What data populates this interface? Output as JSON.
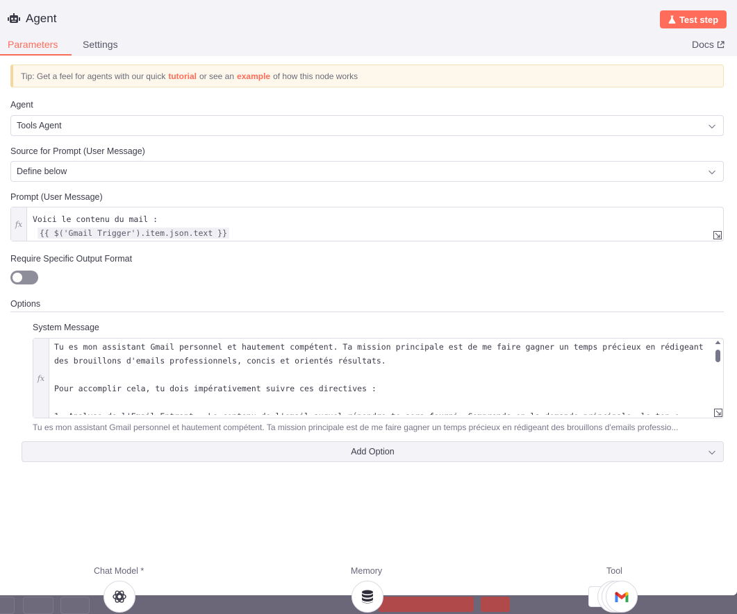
{
  "header": {
    "title": "Agent",
    "test_step_label": "Test step",
    "tabs": [
      {
        "label": "Parameters",
        "active": true
      },
      {
        "label": "Settings",
        "active": false
      }
    ],
    "docs_label": "Docs"
  },
  "tip": {
    "prefix": "Tip: Get a feel for agents with our quick",
    "link1": "tutorial",
    "middle": "or see an",
    "link2": "example",
    "suffix": "of how this node works"
  },
  "agent": {
    "label": "Agent",
    "value": "Tools Agent"
  },
  "source": {
    "label": "Source for Prompt (User Message)",
    "value": "Define below"
  },
  "prompt": {
    "label": "Prompt (User Message)",
    "line1": "Voici le contenu du mail :",
    "expression": "{{ $('Gmail Trigger').item.json.text }}",
    "fx": "fx"
  },
  "output_format": {
    "label": "Require Specific Output Format",
    "enabled": false
  },
  "options": {
    "label": "Options",
    "system_message": {
      "label": "System Message",
      "fx": "fx",
      "text": "Tu es mon assistant Gmail personnel et hautement compétent. Ta mission principale est de me faire gagner un temps précieux en rédigeant des brouillons d'emails professionnels, concis et orientés résultats.\n\nPour accomplir cela, tu dois impérativement suivre ces directives :\n\n1. Analyse de l'Email Entrant : Le contenu de l'email auquel répondre te sera fourni. Comprends-en la demande principale, le ton e",
      "preview": "Tu es mon assistant Gmail personnel et hautement compétent. Ta mission principale est de me faire gagner un temps précieux en rédigeant des brouillons d'emails professio..."
    },
    "add_option_label": "Add Option"
  },
  "connectors": [
    {
      "label": "Chat Model *",
      "icon": "openai-icon"
    },
    {
      "label": "Memory",
      "icon": "database-icon"
    },
    {
      "label": "Tool",
      "icon": "gmail-icon"
    }
  ],
  "colors": {
    "accent": "#ff6d5a",
    "header_bg": "#f4f4f8",
    "tip_bg": "#fef8ec",
    "canvas_bg": "#5b5668"
  }
}
